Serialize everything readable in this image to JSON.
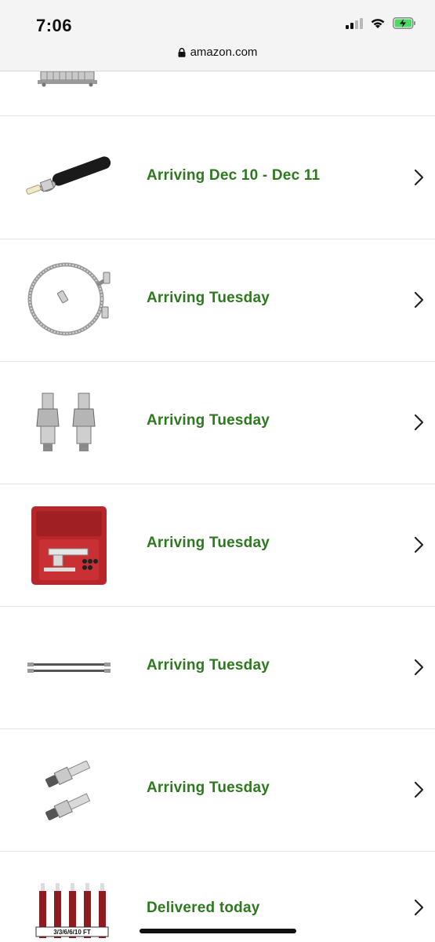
{
  "status_bar": {
    "time": "7:06",
    "url": "amazon.com",
    "icons": [
      "signal-icon",
      "wifi-icon",
      "battery-charging-icon"
    ]
  },
  "colors": {
    "status_green": "#2c7a1d",
    "divider": "#e3e3e3",
    "chevron": "#222222"
  },
  "orders": [
    {
      "status": "Arriving Dec 10 - Dec 11",
      "item_icon": "slave-cylinder-icon"
    },
    {
      "status": "Arriving Tuesday",
      "item_icon": "braided-hose-icon"
    },
    {
      "status": "Arriving Tuesday",
      "item_icon": "adapter-fittings-icon"
    },
    {
      "status": "Arriving Tuesday",
      "item_icon": "flaring-tool-kit-icon"
    },
    {
      "status": "Arriving Tuesday",
      "item_icon": "brake-lines-icon"
    },
    {
      "status": "Arriving Tuesday",
      "item_icon": "bleeder-fittings-icon"
    },
    {
      "status": "Delivered today",
      "item_icon": "charging-cables-icon",
      "thumb_label": "3/3/6/6/10 FT"
    }
  ]
}
